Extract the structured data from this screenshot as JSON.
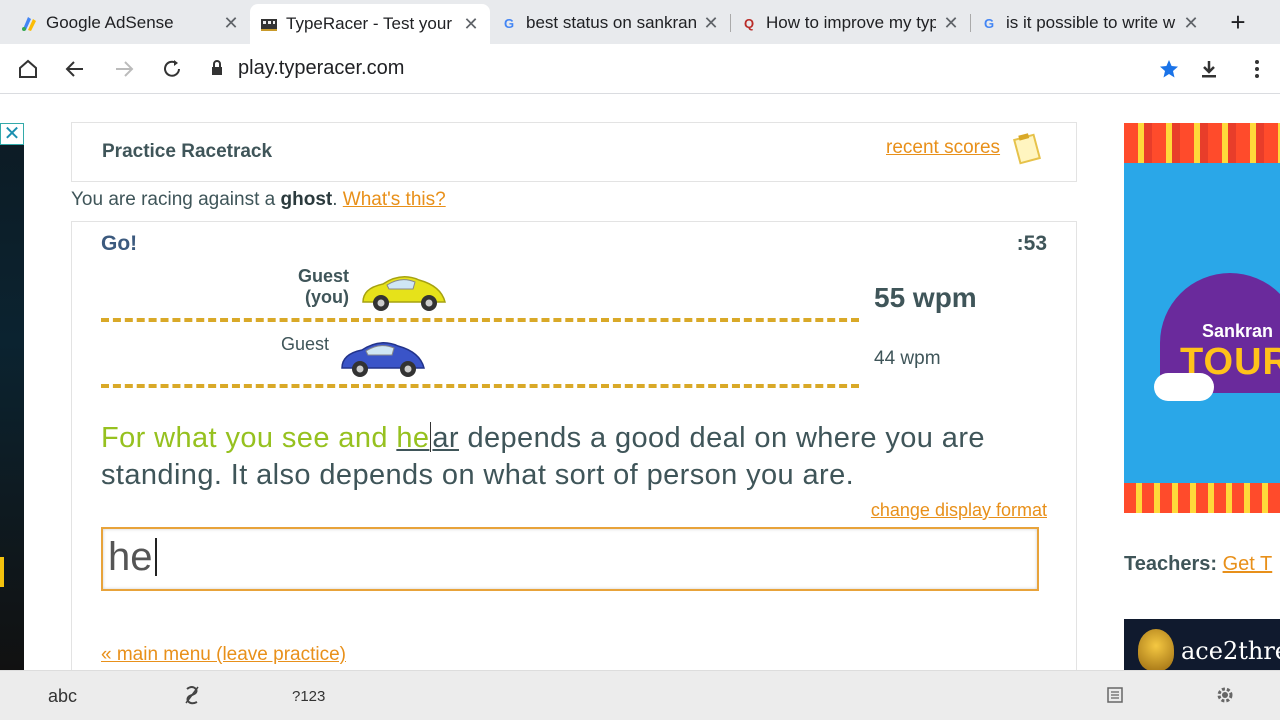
{
  "tabs": [
    {
      "title": "Google AdSense",
      "favicon": "adsense-icon"
    },
    {
      "title": "TypeRacer - Test your",
      "favicon": "typeracer-icon",
      "active": true
    },
    {
      "title": "best status on sankran",
      "favicon": "google-icon"
    },
    {
      "title": "How to improve my typ",
      "favicon": "quora-icon"
    },
    {
      "title": "is it possible to write w",
      "favicon": "google-icon"
    }
  ],
  "toolbar": {
    "url": "play.typeracer.com"
  },
  "header": {
    "title": "Practice Racetrack",
    "recent_scores": "recent scores"
  },
  "ghost_notice": {
    "prefix": "You are racing against a",
    "bold": "ghost",
    "suffix": ".",
    "link": "What's this?"
  },
  "race": {
    "status": "Go!",
    "timer": ":53",
    "lanes": [
      {
        "name": "Guest",
        "subname": "(you)",
        "wpm": "55 wpm",
        "car_color": "yellow"
      },
      {
        "name": "Guest",
        "wpm": "44 wpm",
        "car_color": "blue"
      }
    ],
    "passage": {
      "typed": "For what you see and ",
      "current_done": "he",
      "current_rest": "ar",
      "remaining": " depends a good deal on where you are standing. It also depends on what sort of person you are."
    },
    "change_format": "change display format",
    "input_value": "he",
    "main_menu": "« main menu (leave practice)"
  },
  "right_ad": {
    "line1": "Sankran",
    "line2": "TOURN"
  },
  "teachers": {
    "label": "Teachers",
    "link": "Get T"
  },
  "right_ad2": {
    "text": "ace2thre"
  },
  "keyboard": {
    "abc": "abc",
    "num": "?123"
  }
}
